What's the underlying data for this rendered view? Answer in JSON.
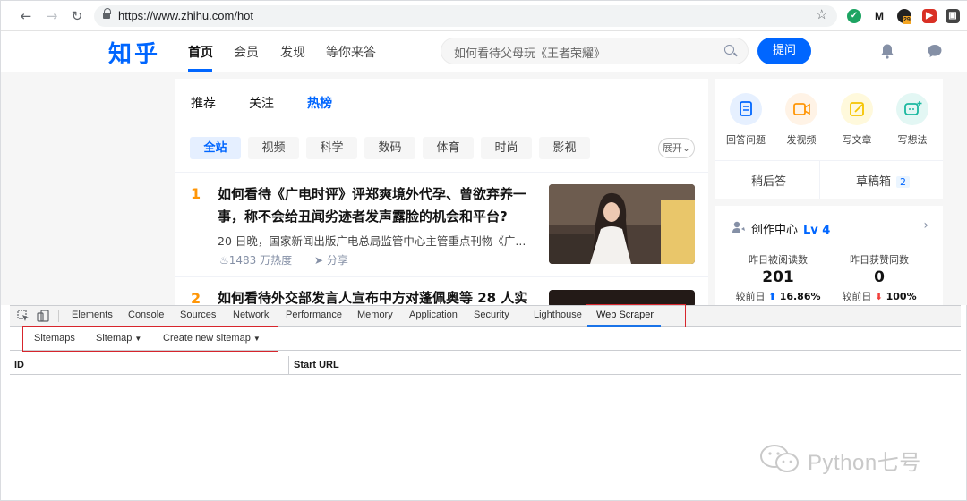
{
  "browser": {
    "url": "https://www.zhihu.com/hot",
    "ext_badge": "29"
  },
  "zhihu": {
    "logo": "知乎",
    "nav": [
      "首页",
      "会员",
      "发现",
      "等你来答"
    ],
    "search_placeholder": "如何看待父母玩《王者荣耀》",
    "ask_button": "提问",
    "tabs": [
      "推荐",
      "关注",
      "热榜"
    ],
    "chips": [
      "全站",
      "视频",
      "科学",
      "数码",
      "体育",
      "时尚",
      "影视"
    ],
    "expand": "展开",
    "hot_items": [
      {
        "rank": "1",
        "title": "如何看待《广电时评》评郑爽境外代孕、曾欲弃养一事，称不会给丑闻劣迹者发声露脸的机会和平台?",
        "excerpt": "20 日晚，国家新闻出版广电总局监管中心主管重点刊物《广...",
        "heat": "1483 万热度",
        "share": "分享"
      },
      {
        "rank": "2",
        "title": "如何看待外交部发言人宣布中方对蓬佩奥等 28 人实"
      }
    ],
    "create": {
      "items": [
        "回答问题",
        "发视频",
        "写文章",
        "写想法"
      ],
      "later": "稍后答",
      "drafts": "草稿箱",
      "drafts_count": "2"
    },
    "creator_center": {
      "title": "创作中心",
      "level": "Lv 4",
      "stats": [
        {
          "label": "昨日被阅读数",
          "value": "201",
          "delta_label": "较前日",
          "delta": "16.86%",
          "direction": "up"
        },
        {
          "label": "昨日获赞同数",
          "value": "0",
          "delta_label": "较前日",
          "delta": "100%",
          "direction": "down"
        }
      ]
    }
  },
  "devtools": {
    "tabs": [
      "Elements",
      "Console",
      "Sources",
      "Network",
      "Performance",
      "Memory",
      "Application",
      "Security",
      "Lighthouse",
      "Web Scraper"
    ],
    "active_tab": "Web Scraper",
    "scraper_menu": [
      "Sitemaps",
      "Sitemap",
      "Create new sitemap"
    ],
    "columns": [
      "ID",
      "Start URL"
    ]
  },
  "watermark": "Python七号",
  "colors": {
    "brand": "#0066ff",
    "rank": "#ff9607",
    "highlight": "#d7252c"
  }
}
